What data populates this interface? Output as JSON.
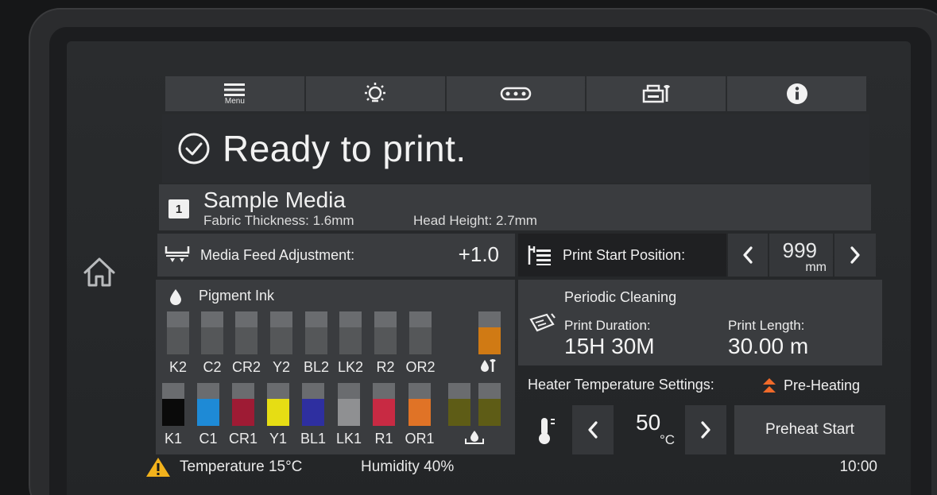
{
  "topbar": {
    "menu_label": "Menu"
  },
  "status": {
    "title": "Ready to print."
  },
  "media": {
    "number": "1",
    "name": "Sample Media",
    "thickness": "Fabric Thickness: 1.6mm",
    "head_height": "Head Height: 2.7mm"
  },
  "feed": {
    "label": "Media Feed Adjustment:",
    "value": "+1.0"
  },
  "print_start": {
    "label": "Print Start Position:",
    "value": "999",
    "unit": "mm"
  },
  "ink": {
    "header": "Pigment Ink",
    "row1": [
      {
        "label": "K2",
        "color": "#555759"
      },
      {
        "label": "C2",
        "color": "#555759"
      },
      {
        "label": "CR2",
        "color": "#555759"
      },
      {
        "label": "Y2",
        "color": "#555759"
      },
      {
        "label": "BL2",
        "color": "#555759"
      },
      {
        "label": "LK2",
        "color": "#555759"
      },
      {
        "label": "R2",
        "color": "#555759"
      },
      {
        "label": "OR2",
        "color": "#555759"
      }
    ],
    "row2": [
      {
        "label": "K1",
        "color": "#0a0a0a"
      },
      {
        "label": "C1",
        "color": "#1e8ad6"
      },
      {
        "label": "CR1",
        "color": "#9e1b34"
      },
      {
        "label": "Y1",
        "color": "#e6dd14"
      },
      {
        "label": "BL1",
        "color": "#2e2fa0"
      },
      {
        "label": "LK1",
        "color": "#8f9092"
      },
      {
        "label": "R1",
        "color": "#c82a43"
      },
      {
        "label": "OR1",
        "color": "#e07326"
      }
    ],
    "extra_top_color": "#d07a14",
    "waste_colors": [
      "#5e5c16",
      "#5e5c16"
    ]
  },
  "cleaning": {
    "title": "Periodic Cleaning",
    "duration_label": "Print Duration:",
    "duration_value": "15H  30M",
    "length_label": "Print Length:",
    "length_value": "30.00 m"
  },
  "heater": {
    "label": "Heater Temperature Settings:",
    "mode": "Pre-Heating",
    "value": "50",
    "unit": "°C",
    "button": "Preheat Start"
  },
  "footer": {
    "temperature": "Temperature  15°C",
    "humidity": "Humidity  40%",
    "time": "10:00"
  },
  "colors": {
    "accent_warning": "#f2b21c",
    "pre_heating": "#f06a2a"
  }
}
